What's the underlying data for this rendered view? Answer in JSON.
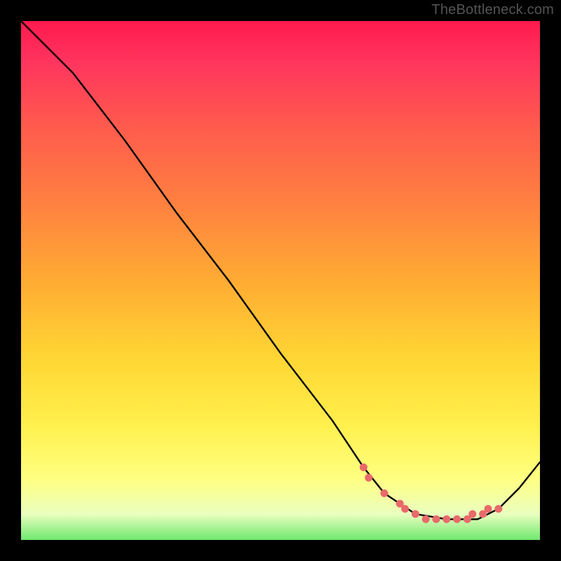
{
  "watermark": "TheBottleneck.com",
  "chart_data": {
    "type": "line",
    "title": "",
    "xlabel": "",
    "ylabel": "",
    "xlim": [
      0,
      100
    ],
    "ylim": [
      0,
      100
    ],
    "series": [
      {
        "name": "curve",
        "x": [
          0,
          6,
          10,
          20,
          30,
          40,
          50,
          60,
          66,
          70,
          76,
          82,
          88,
          92,
          96,
          100
        ],
        "y": [
          100,
          94,
          90,
          77,
          63,
          50,
          36,
          23,
          14,
          9,
          5,
          4,
          4,
          6,
          10,
          15
        ]
      }
    ],
    "markers": {
      "name": "highlight-dots",
      "color": "#e86a6a",
      "x": [
        66,
        67,
        70,
        73,
        74,
        76,
        78,
        80,
        82,
        84,
        86,
        87,
        89,
        90,
        92
      ],
      "y": [
        14,
        12,
        9,
        7,
        6,
        5,
        4,
        4,
        4,
        4,
        4,
        5,
        5,
        6,
        6
      ]
    }
  }
}
